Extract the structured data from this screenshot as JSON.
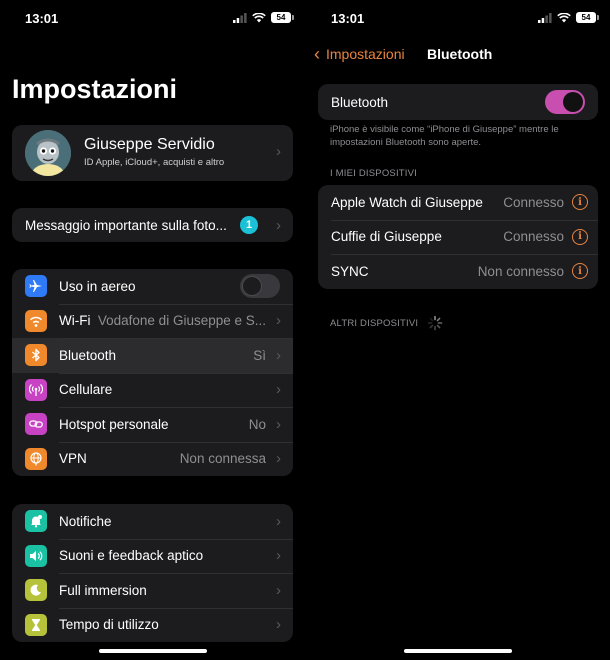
{
  "status": {
    "time": "13:01",
    "battery": "54"
  },
  "settings": {
    "title": "Impostazioni",
    "profile": {
      "name": "Giuseppe Servidio",
      "subtitle": "ID Apple, iCloud+, acquisti e altro"
    },
    "notice": {
      "label": "Messaggio importante sulla foto...",
      "badge": "1"
    },
    "group1": [
      {
        "label": "Uso in aereo",
        "icon": "airplane-icon",
        "color": "#2f7bf5",
        "toggle": "off"
      },
      {
        "label": "Wi-Fi",
        "value": "Vodafone di Giuseppe e S...",
        "icon": "wifi-icon",
        "color": "#f0892b"
      },
      {
        "label": "Bluetooth",
        "value": "Sì",
        "icon": "bluetooth-icon",
        "color": "#f0892b",
        "selected": true
      },
      {
        "label": "Cellulare",
        "icon": "antenna-icon",
        "color": "#c843c4"
      },
      {
        "label": "Hotspot personale",
        "value": "No",
        "icon": "hotspot-icon",
        "color": "#c843c4"
      },
      {
        "label": "VPN",
        "value": "Non connessa",
        "icon": "globe-icon",
        "color": "#f0892b"
      }
    ],
    "group2": [
      {
        "label": "Notifiche",
        "icon": "bell-icon",
        "color": "#1ac1a3"
      },
      {
        "label": "Suoni e feedback aptico",
        "icon": "speaker-icon",
        "color": "#1ac1a3"
      },
      {
        "label": "Full immersion",
        "icon": "moon-icon",
        "color": "#b5c23a"
      },
      {
        "label": "Tempo di utilizzo",
        "icon": "hourglass-icon",
        "color": "#b5c23a"
      }
    ]
  },
  "bluetooth": {
    "back_label": "Impostazioni",
    "title": "Bluetooth",
    "toggle_label": "Bluetooth",
    "toggle_state": "on",
    "note": "iPhone è visibile come “iPhone di Giuseppe” mentre le impostazioni Bluetooth sono aperte.",
    "my_devices_header": "I MIEI DISPOSITIVI",
    "devices": [
      {
        "name": "Apple Watch di Giuseppe",
        "status": "Connesso"
      },
      {
        "name": "Cuffie di Giuseppe",
        "status": "Connesso"
      },
      {
        "name": "SYNC",
        "status": "Non connesso"
      }
    ],
    "other_devices_header": "ALTRI DISPOSITIVI"
  },
  "colors": {
    "accent": "#e8843f",
    "toggle_on": "#c84fb0",
    "badge": "#1ac1d7"
  }
}
